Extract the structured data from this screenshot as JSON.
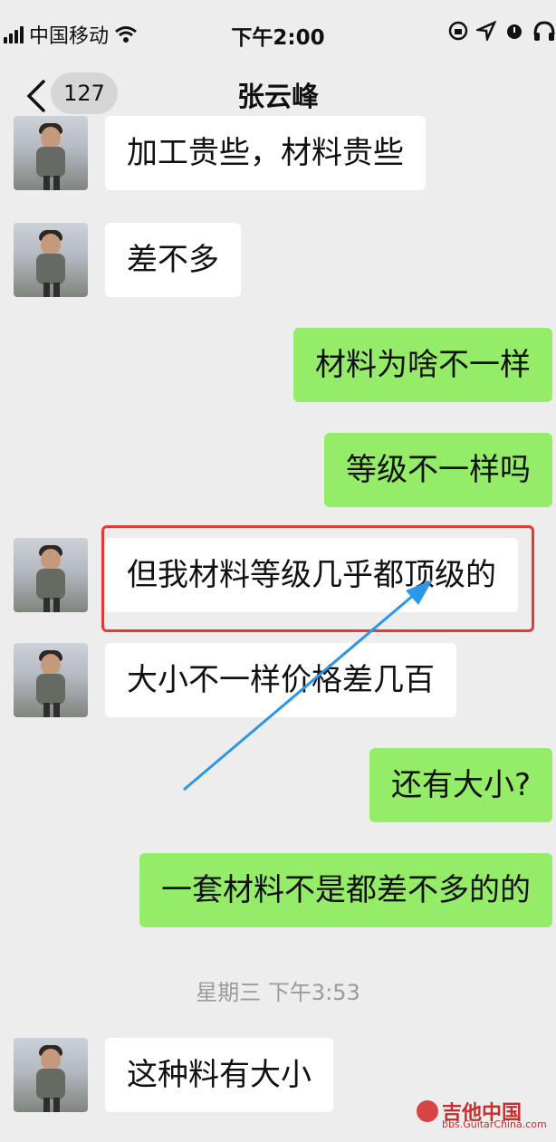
{
  "status_bar": {
    "carrier": "中国移动",
    "time": "下午2:00"
  },
  "nav": {
    "unread_count": "127",
    "title": "张云峰"
  },
  "messages": [
    {
      "side": "in",
      "text": "加工贵些，材料贵些"
    },
    {
      "side": "in",
      "text": "差不多"
    },
    {
      "side": "out",
      "text": "材料为啥不一样"
    },
    {
      "side": "out",
      "text": "等级不一样吗"
    },
    {
      "side": "in",
      "text": "但我材料等级几乎都顶级的"
    },
    {
      "side": "in",
      "text": "大小不一样价格差几百"
    },
    {
      "side": "out",
      "text": "还有大小?"
    },
    {
      "side": "out",
      "text": "一套材料不是都差不多的的"
    },
    {
      "side": "in",
      "text": "这种料有大小"
    }
  ],
  "timestamp": "星期三 下午3:53",
  "watermark": {
    "main": "吉他中国",
    "sub": "bbs.GuitarChina.com"
  },
  "colors": {
    "background": "#ededed",
    "incoming_bubble": "#ffffff",
    "outgoing_bubble": "#95ec69",
    "highlight_box": "#e53a35",
    "arrow": "#2b97e8"
  },
  "icons": [
    "signal-bars-icon",
    "wifi-icon",
    "rotation-lock-icon",
    "location-icon",
    "alarm-icon",
    "headphones-icon",
    "back-chevron-icon"
  ]
}
